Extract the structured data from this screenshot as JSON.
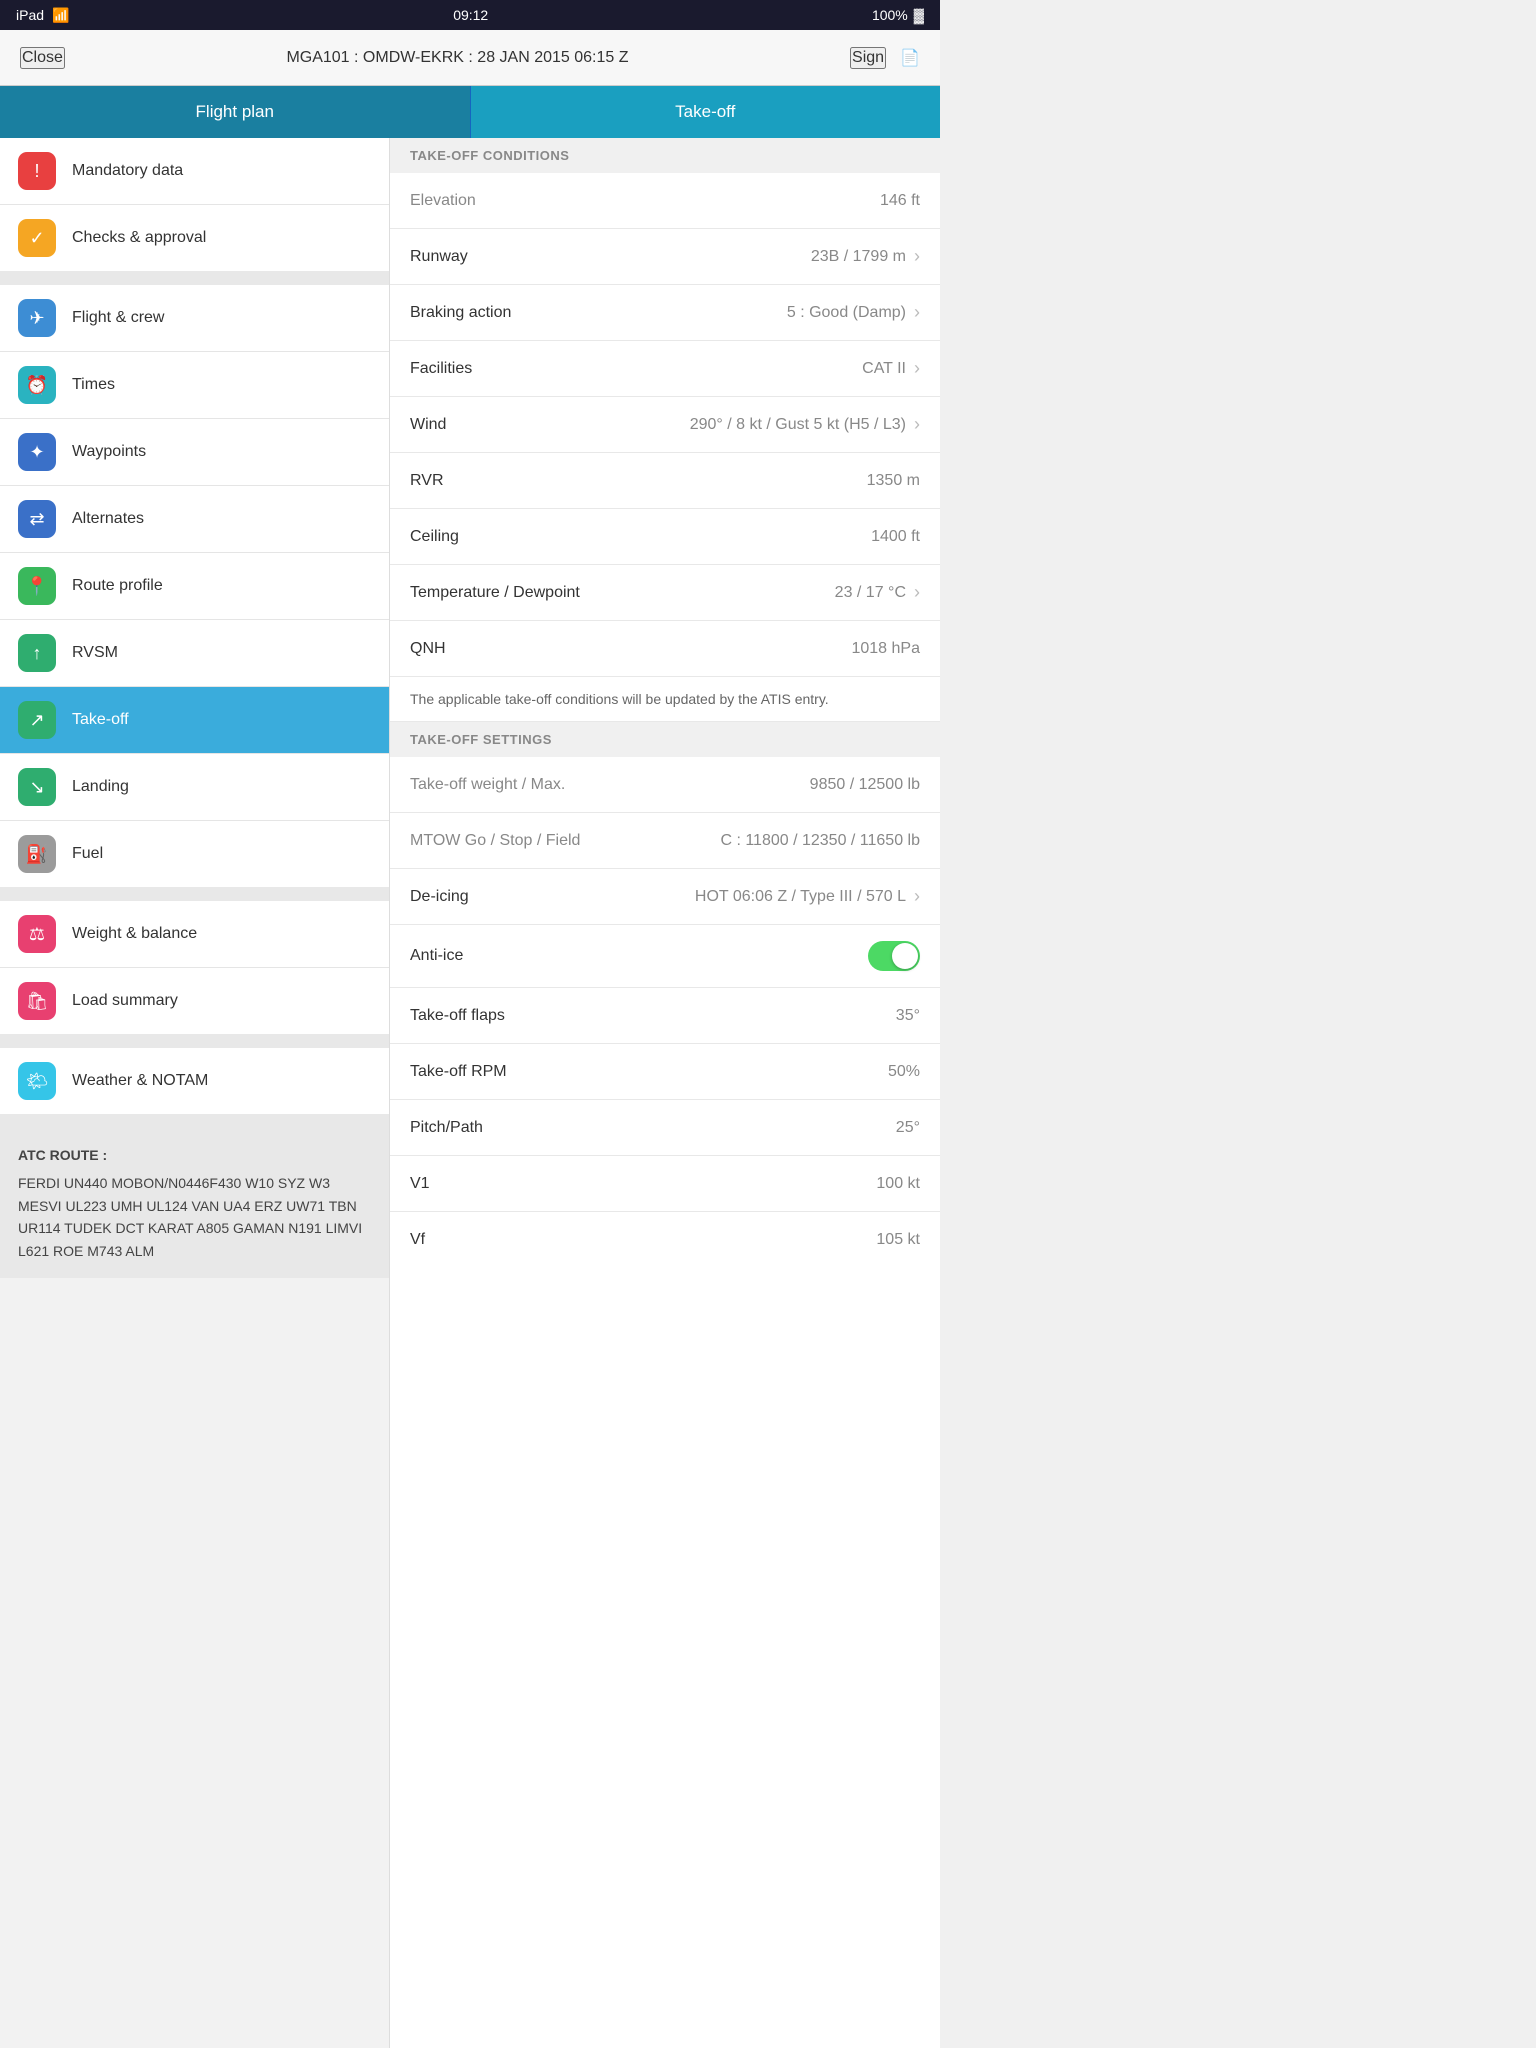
{
  "status_bar": {
    "left": "iPad",
    "wifi": "wifi",
    "time": "09:12",
    "battery_pct": "100%",
    "battery_icon": "🔋"
  },
  "nav_bar": {
    "close_label": "Close",
    "title": "MGA101 : OMDW-EKRK : 28 JAN 2015 06:15 Z",
    "sign_label": "Sign",
    "doc_icon": "📄"
  },
  "tabs": {
    "left_label": "Flight plan",
    "right_label": "Take-off"
  },
  "sidebar": {
    "groups": [
      {
        "items": [
          {
            "id": "mandatory-data",
            "icon": "!",
            "icon_class": "icon-red",
            "label": "Mandatory data"
          },
          {
            "id": "checks-approval",
            "icon": "✓",
            "icon_class": "icon-orange",
            "label": "Checks & approval"
          }
        ]
      },
      {
        "items": [
          {
            "id": "flight-crew",
            "icon": "✈",
            "icon_class": "icon-blue",
            "label": "Flight & crew"
          },
          {
            "id": "times",
            "icon": "🕐",
            "icon_class": "icon-teal",
            "label": "Times"
          },
          {
            "id": "waypoints",
            "icon": "⌘",
            "icon_class": "icon-navy",
            "label": "Waypoints"
          },
          {
            "id": "alternates",
            "icon": "⇄",
            "icon_class": "icon-navy",
            "label": "Alternates"
          },
          {
            "id": "route-profile",
            "icon": "📍",
            "icon_class": "icon-green",
            "label": "Route profile"
          },
          {
            "id": "rvsm",
            "icon": "↑",
            "icon_class": "icon-green2",
            "label": "RVSM"
          },
          {
            "id": "takeoff",
            "icon": "↗",
            "icon_class": "icon-green2",
            "label": "Take-off",
            "active": true
          },
          {
            "id": "landing",
            "icon": "↘",
            "icon_class": "icon-green2",
            "label": "Landing"
          },
          {
            "id": "fuel",
            "icon": "⛽",
            "icon_class": "icon-gray",
            "label": "Fuel"
          }
        ]
      },
      {
        "items": [
          {
            "id": "weight-balance",
            "icon": "⚖",
            "icon_class": "icon-pink",
            "label": "Weight & balance"
          },
          {
            "id": "load-summary",
            "icon": "🛍",
            "icon_class": "icon-pink2",
            "label": "Load summary"
          }
        ]
      },
      {
        "items": [
          {
            "id": "weather-notam",
            "icon": "🌤",
            "icon_class": "icon-sky",
            "label": "Weather & NOTAM"
          }
        ]
      }
    ],
    "atc_route": {
      "title": "ATC ROUTE :",
      "text": "FERDI UN440 MOBON/N0446F430 W10 SYZ W3 MESVI UL223 UMH UL124 VAN UA4 ERZ UW71 TBN UR114 TUDEK DCT KARAT A805 GAMAN N191 LIMVI L621 ROE M743 ALM"
    }
  },
  "content": {
    "sections": [
      {
        "header": "TAKE-OFF CONDITIONS",
        "rows": [
          {
            "id": "elevation",
            "label": "Elevation",
            "value": "146 ft",
            "muted": true,
            "chevron": false
          },
          {
            "id": "runway",
            "label": "Runway",
            "value": "23B / 1799 m",
            "muted": false,
            "chevron": true
          },
          {
            "id": "braking-action",
            "label": "Braking action",
            "value": "5 : Good (Damp)",
            "muted": false,
            "chevron": true
          },
          {
            "id": "facilities",
            "label": "Facilities",
            "value": "CAT II",
            "muted": false,
            "chevron": true
          },
          {
            "id": "wind",
            "label": "Wind",
            "value": "290° / 8 kt / Gust 5 kt (H5 / L3)",
            "muted": false,
            "chevron": true
          },
          {
            "id": "rvr",
            "label": "RVR",
            "value": "1350 m",
            "muted": false,
            "chevron": false
          },
          {
            "id": "ceiling",
            "label": "Ceiling",
            "value": "1400 ft",
            "muted": false,
            "chevron": false
          },
          {
            "id": "temp-dewpoint",
            "label": "Temperature / Dewpoint",
            "value": "23 / 17 °C",
            "muted": false,
            "chevron": true
          },
          {
            "id": "qnh",
            "label": "QNH",
            "value": "1018 hPa",
            "muted": false,
            "chevron": false
          }
        ]
      }
    ],
    "info_text": "The applicable take-off conditions will be updated by the ATIS entry.",
    "settings_section": {
      "header": "TAKE-OFF SETTINGS",
      "rows": [
        {
          "id": "takeoff-weight",
          "label": "Take-off weight / Max.",
          "value": "9850 / 12500 lb",
          "muted": true,
          "chevron": false
        },
        {
          "id": "mtow",
          "label": "MTOW Go / Stop / Field",
          "value": "C : 11800 / 12350 / 11650 lb",
          "muted": true,
          "chevron": false
        },
        {
          "id": "de-icing",
          "label": "De-icing",
          "value": "HOT 06:06 Z / Type III / 570 L",
          "muted": false,
          "chevron": true
        },
        {
          "id": "anti-ice",
          "label": "Anti-ice",
          "value": "toggle",
          "muted": false,
          "chevron": false
        },
        {
          "id": "takeoff-flaps",
          "label": "Take-off flaps",
          "value": "35°",
          "muted": false,
          "chevron": false
        },
        {
          "id": "takeoff-rpm",
          "label": "Take-off RPM",
          "value": "50%",
          "muted": false,
          "chevron": false
        },
        {
          "id": "pitch-path",
          "label": "Pitch/Path",
          "value": "25°",
          "muted": false,
          "chevron": false
        },
        {
          "id": "v1",
          "label": "V1",
          "value": "100 kt",
          "muted": false,
          "chevron": false
        },
        {
          "id": "vf",
          "label": "Vf",
          "value": "105 kt",
          "muted": false,
          "chevron": false
        }
      ]
    }
  }
}
